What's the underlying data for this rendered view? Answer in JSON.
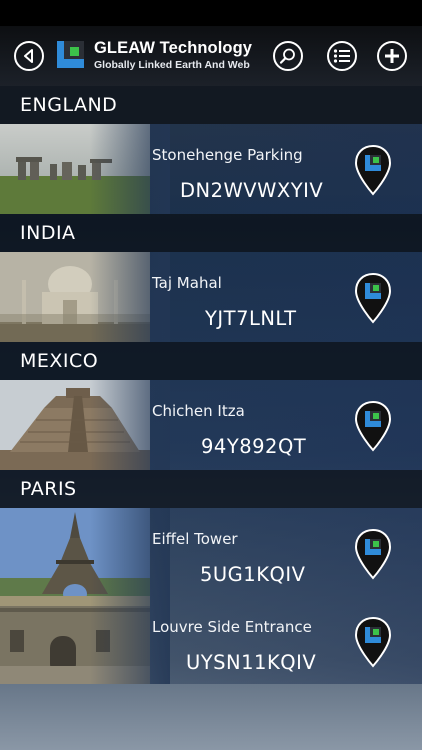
{
  "header": {
    "title": "GLEAW Technology",
    "subtitle": "Globally Linked Earth And Web",
    "back_icon": "back-arrow-icon",
    "search_icon": "search-icon",
    "list_icon": "list-icon",
    "add_icon": "plus-icon"
  },
  "colors": {
    "brand_blue": "#2f8bd9",
    "brand_green": "#3cc24a",
    "section_bg": "#0b1016"
  },
  "sections": [
    {
      "name": "ENGLAND",
      "places": [
        {
          "name": "Stonehenge Parking",
          "code": "DN2WVWXYIV"
        }
      ]
    },
    {
      "name": "INDIA",
      "places": [
        {
          "name": "Taj Mahal",
          "code": "YJT7LNLT"
        }
      ]
    },
    {
      "name": "MEXICO",
      "places": [
        {
          "name": "Chichen Itza",
          "code": "94Y892QT"
        }
      ]
    },
    {
      "name": "PARIS",
      "places": [
        {
          "name": "Eiffel Tower",
          "code": "5UG1KQIV"
        },
        {
          "name": "Louvre Side Entrance",
          "code": "UYSN11KQIV"
        }
      ]
    }
  ]
}
